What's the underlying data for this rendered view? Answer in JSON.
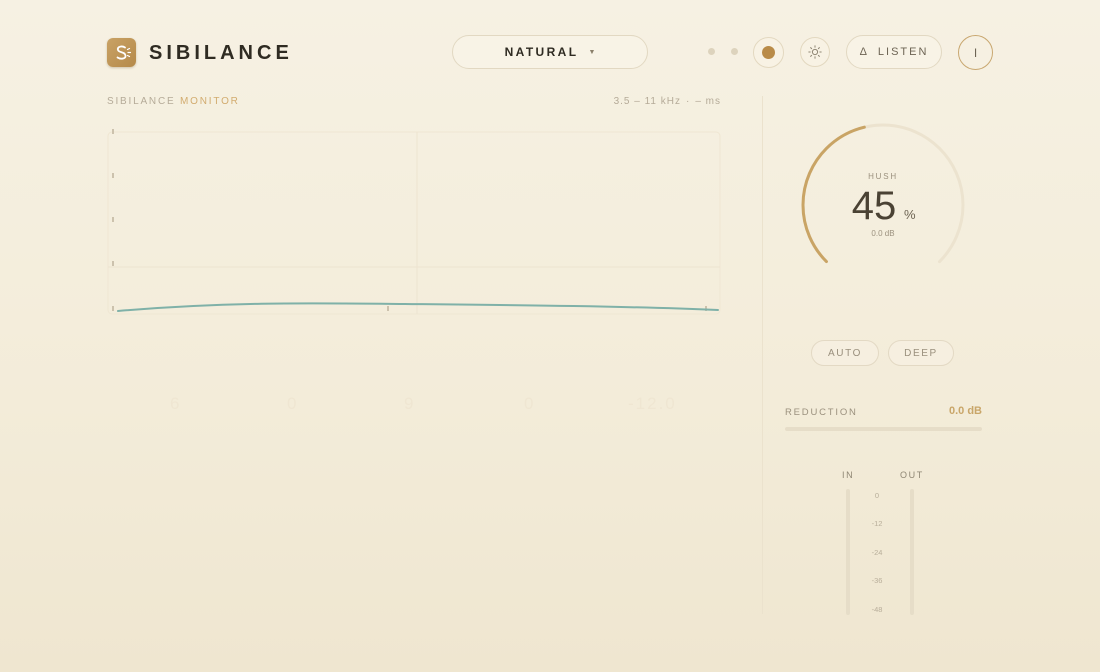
{
  "header": {
    "app_title": "SIBILANCE",
    "logo_icon": "sibilance-logo-icon",
    "preset": {
      "selected": "NATURAL"
    },
    "listen_label": "LISTEN",
    "power_glyph": "I",
    "listen_glyph": "Δ"
  },
  "monitor": {
    "title_prefix": "SIBILANCE",
    "title_accent": "MONITOR",
    "range": "3.5 – 11 kHz",
    "separator": "·",
    "time": "– ms",
    "ghost_scale": [
      "6",
      "0",
      "9",
      "0",
      "-12.0"
    ]
  },
  "knob": {
    "label": "HUSH",
    "value": 45,
    "unit": "%",
    "db": "0.0 dB"
  },
  "modes": {
    "auto": "AUTO",
    "deep": "DEEP"
  },
  "reduction": {
    "label": "REDUCTION",
    "value": "0.0 dB",
    "level": 0
  },
  "meters": {
    "in_label": "IN",
    "out_label": "OUT",
    "ticks": [
      "0",
      "-12",
      "-24",
      "-36",
      "-48"
    ]
  },
  "colors": {
    "accent": "#c9a669",
    "accent_dark": "#b98b48",
    "trace": "#7fb1a8",
    "background": "#f4eddc"
  }
}
